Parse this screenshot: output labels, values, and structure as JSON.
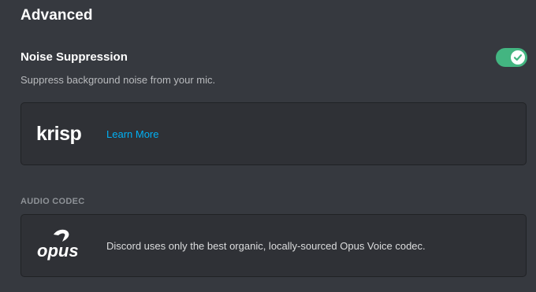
{
  "section": {
    "title": "Advanced"
  },
  "noise_suppression": {
    "title": "Noise Suppression",
    "description": "Suppress background noise from your mic.",
    "enabled": true,
    "toggle_color": "#43b581"
  },
  "krisp": {
    "logo_text": "krisp",
    "logo_icon": "krisp-logo",
    "link_label": "Learn More",
    "link_color": "#00b0f4"
  },
  "audio_codec": {
    "label": "AUDIO CODEC",
    "logo_text": "opus",
    "logo_icon": "opus-logo",
    "description": "Discord uses only the best organic, locally-sourced Opus Voice codec."
  }
}
